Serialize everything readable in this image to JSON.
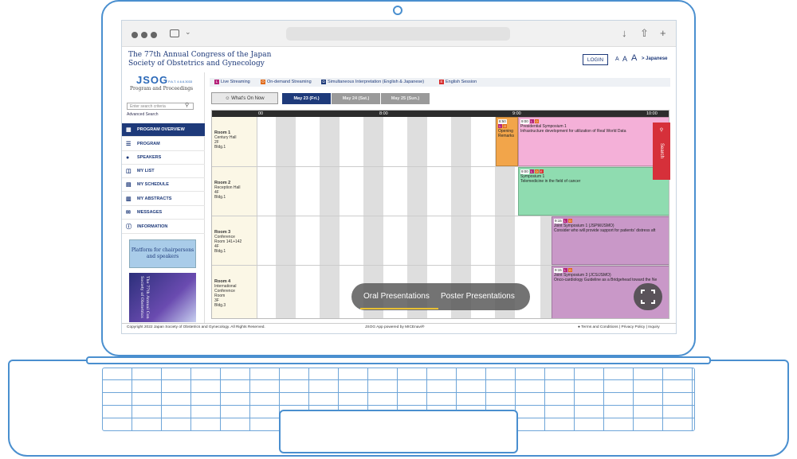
{
  "site": {
    "title_line1": "The 77th Annual Congress of the Japan",
    "title_line2": "Society of Obstetrics and Gynecology",
    "login": "LOGIN",
    "font_a_small": "A",
    "font_a_mid": "A",
    "font_a_large": "A",
    "language": "> Japanese"
  },
  "nav": {
    "logo": "JSOG",
    "logo_sub": "P.A.T. 4.6.6.3033",
    "logo_caption": "Program and Proceedings",
    "search_placeholder": "Enter search criteria",
    "advanced_search": "Advanced Search",
    "items": [
      {
        "label": "PROGRAM OVERVIEW",
        "icon": "calendar-grid-icon"
      },
      {
        "label": "PROGRAM",
        "icon": "list-icon"
      },
      {
        "label": "SPEAKERS",
        "icon": "person-icon"
      },
      {
        "label": "MY LIST",
        "icon": "book-icon"
      },
      {
        "label": "MY SCHEDULE",
        "icon": "calendar-icon"
      },
      {
        "label": "MY ABSTRACTS",
        "icon": "abstracts-icon"
      },
      {
        "label": "MESSAGES",
        "icon": "envelope-icon"
      },
      {
        "label": "INFORMATION",
        "icon": "info-icon"
      }
    ],
    "banner1": "Platform for chairpersons and speakers",
    "banner2": "The 77th Annual Con Society of Obstetrics"
  },
  "legend": {
    "live": "Live Streaming",
    "on_demand": "On-demand Streaming",
    "simultaneous": "Simultaneous Interpretation (English & Japanese)",
    "english": "English Session",
    "colors": {
      "live": "#b5237a",
      "on_demand": "#e06a1a",
      "simultaneous": "#1e3a7a",
      "english": "#d62d2d"
    }
  },
  "tabs": {
    "whats_on_now": "What's On Now",
    "days": [
      "May 23 (Fri.)",
      "May 24 (Sat.)",
      "May 25 (Sun.)"
    ],
    "active_day": 0
  },
  "timeline": {
    "labels": [
      "00",
      "8:00",
      "9:00",
      "10:00"
    ]
  },
  "rooms": [
    {
      "name": "Room 1",
      "l1": "Century Hall",
      "l2": "2F",
      "l3": "Bldg.1"
    },
    {
      "name": "Room 2",
      "l1": "Reception Hall",
      "l2": "4F",
      "l3": "Bldg.1"
    },
    {
      "name": "Room 3",
      "l1": "Conference",
      "l2": "Room 141+142",
      "l3": "4F",
      "l4": "Bldg.1"
    },
    {
      "name": "Room 4",
      "l1": "International",
      "l2": "Conference",
      "l3": "Room",
      "l4": "3F",
      "l5": "Bldg.3"
    }
  ],
  "events": [
    {
      "time": "8:50",
      "badges": "L O",
      "title": "Opening Remarks"
    },
    {
      "time": "9:00",
      "badges": "L O",
      "title": "Presidential Symposium 1",
      "subtitle": "Infrastructure development for utilization of Real World Data"
    },
    {
      "time": "9:00",
      "badges": "L O E",
      "title": "Symposium 1",
      "subtitle": "Telemedicine in the field of cancer"
    },
    {
      "time": "9:15",
      "badges": "L O",
      "title": "Joint Symposium 1 (JSPM/JSMO)",
      "subtitle": "Consider who will provide support for patients' distress aft"
    },
    {
      "time": "9:15",
      "badges": "L O",
      "title": "Joint Symposium 3 (JCS/JSMO)",
      "subtitle": "Onco-cardiology Guideline as a Bridgehead toward the Ne"
    }
  ],
  "side_search": "Search",
  "overlay": {
    "oral": "Oral Presentations",
    "poster": "Poster Presentations"
  },
  "footer": {
    "copyright": "Copyright 2022 Japan Society of Obstetrics and Gynecology. All Rights Reserved.",
    "powered": "JSOG App powered by MICEnavi®",
    "links": "Terms and Conditions | Privacy Policy | Inquiry"
  }
}
